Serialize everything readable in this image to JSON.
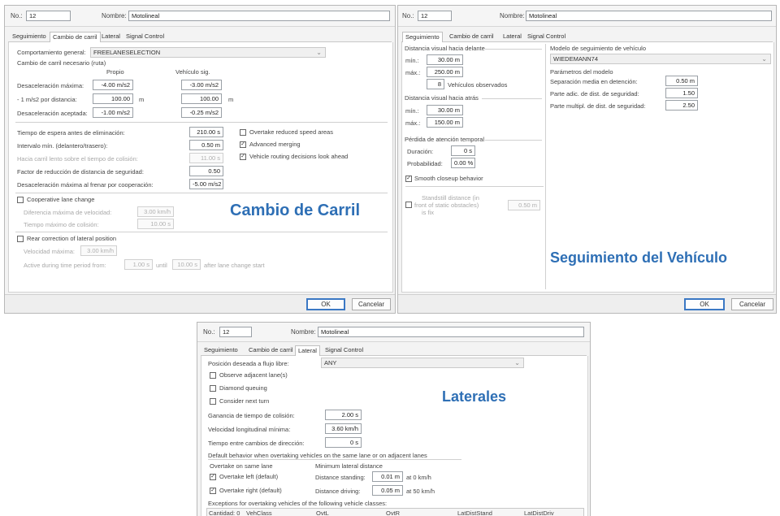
{
  "left": {
    "no_label": "No.:",
    "no_value": "12",
    "name_label": "Nombre:",
    "name_value": "Motolineal",
    "tabs": [
      "Seguimiento",
      "Cambio de carril",
      "Lateral",
      "Signal Control"
    ],
    "comportamiento_label": "Comportamiento general:",
    "comportamiento_value": "FREELANESELECTION",
    "cambio_necesario": "Cambio de carril necesario (ruta)",
    "col_propio": "Propio",
    "col_sig": "Vehículo sig.",
    "rows": [
      {
        "label": "Desaceleración máxima:",
        "v1": "-4.00 m/s2",
        "v2": "-3.00 m/s2",
        "unit": ""
      },
      {
        "label": "- 1 m/s2 por distancia:",
        "v1": "100.00",
        "v2": "100.00",
        "unit": "m"
      },
      {
        "label": "Desaceleración aceptada:",
        "v1": "-1.00 m/s2",
        "v2": "-0.25 m/s2",
        "unit": ""
      }
    ],
    "params": [
      {
        "label": "Tiempo de espera antes de eliminación:",
        "value": "210.00 s",
        "disabled": false
      },
      {
        "label": "Intervalo mín. (delantero/trasero):",
        "value": "0.50 m",
        "disabled": false
      },
      {
        "label": "Hacia carril lento sobre el tiempo de colisión:",
        "value": "11.00 s",
        "disabled": true
      },
      {
        "label": "Factor de reducción de distancia de seguridad:",
        "value": "0.50",
        "disabled": false
      },
      {
        "label": "Desaceleración máxima al frenar por cooperación:",
        "value": "-5.00 m/s2",
        "disabled": false
      }
    ],
    "checks": [
      {
        "label": "Overtake reduced speed areas",
        "checked": false
      },
      {
        "label": "Advanced merging",
        "checked": true
      },
      {
        "label": "Vehicle routing decisions look ahead",
        "checked": true
      }
    ],
    "coop_label": "Cooperative lane change",
    "coop_speed_label": "Diferencia máxima de velocidad:",
    "coop_speed": "3.00 km/h",
    "coop_time_label": "Tiempo máximo de colisión:",
    "coop_time": "10.00 s",
    "rear_label": "Rear correction of lateral position",
    "rear_speed_label": "Velocidad máxima:",
    "rear_speed": "3.00 km/h",
    "active_label": "Active during time period from:",
    "active_from": "1.00 s",
    "until": "until",
    "active_until": "10.00 s",
    "after": "after lane change start",
    "caption": "Cambio de Carril",
    "ok": "OK",
    "cancel": "Cancelar"
  },
  "right": {
    "no_label": "No.:",
    "no_value": "12",
    "name_label": "Nombre:",
    "name_value": "Motolineal",
    "tabs": [
      "Seguimiento",
      "Cambio de carril",
      "Lateral",
      "Signal Control"
    ],
    "ahead_title": "Distancia visual hacia delante",
    "min_label": "mín.:",
    "max_label": "máx.:",
    "ahead_min": "30.00 m",
    "ahead_max": "250.00 m",
    "observed": "8",
    "observed_label": "Vehículos observados",
    "back_title": "Distancia visual hacia atrás",
    "back_min": "30.00 m",
    "back_max": "150.00 m",
    "lapse_title": "Pérdida de atención temporal",
    "dur_label": "Duración:",
    "dur_value": "0 s",
    "prob_label": "Probabilidad:",
    "prob_value": "0.00 %",
    "smooth_label": "Smooth closeup behavior",
    "standstill_label_1": "Standstill distance (in",
    "standstill_label_2": "front of static obstacles)",
    "standstill_label_3": "is fix",
    "standstill_value": "0.50 m",
    "model_title": "Modelo de seguimiento de vehículo",
    "model_value": "WIEDEMANN74",
    "params_title": "Parámetros del modelo",
    "model_params": [
      {
        "label": "Separación media en detención:",
        "value": "0.50 m"
      },
      {
        "label": "Parte adic. de dist. de seguridad:",
        "value": "1.50"
      },
      {
        "label": "Parte multipl. de dist. de seguridad:",
        "value": "2.50"
      }
    ],
    "caption": "Seguimiento del Vehículo",
    "ok": "OK",
    "cancel": "Cancelar"
  },
  "bottom": {
    "no_label": "No.:",
    "no_value": "12",
    "name_label": "Nombre:",
    "name_value": "Motolineal",
    "tabs": [
      "Seguimiento",
      "Cambio de carril",
      "Lateral",
      "Signal Control"
    ],
    "pos_label": "Posición deseada a flujo libre:",
    "pos_value": "ANY",
    "checks": [
      "Observe adjacent lane(s)",
      "Diamond queuing",
      "Consider next turn"
    ],
    "caption": "Laterales",
    "fields": [
      {
        "label": "Ganancia de tiempo de colisión:",
        "value": "2.00 s"
      },
      {
        "label": "Velocidad longitudinal mínima:",
        "value": "3.60 km/h"
      },
      {
        "label": "Tiempo entre cambios de dirección:",
        "value": "0 s"
      }
    ],
    "default_label": "Default behavior when overtaking vehicles on the same lane or on adjacent lanes",
    "overtake_title": "Overtake on same lane",
    "min_lat_title": "Minimum lateral distance",
    "ov_left": "Overtake left (default)",
    "ov_right": "Overtake right (default)",
    "dist_standing": "Distance standing:",
    "dist_standing_v": "0.01 m",
    "at0": "at 0 km/h",
    "dist_driving": "Distance driving:",
    "dist_driving_v": "0.05 m",
    "at50": "at 50 km/h",
    "exceptions": "Exceptions for overtaking vehicles of the following vehicle classes:",
    "columns": [
      "Cantidad: 0",
      "VehClass",
      "OvtL",
      "OvtR",
      "LatDistStand",
      "LatDistDriv"
    ]
  }
}
